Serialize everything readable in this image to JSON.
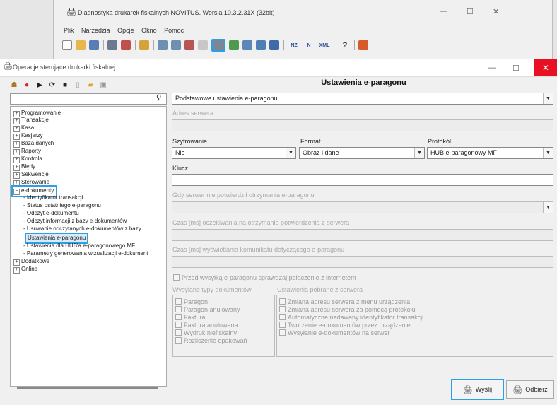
{
  "background_window": {
    "title": "Diagnostyka drukarek fiskalnych NOVITUS. Wersja 10.3.2.31X (32bit)",
    "menu": [
      "Plik",
      "Narzedzia",
      "Opcje",
      "Okno",
      "Pomoc"
    ],
    "toolbar_text": [
      "NZ",
      "N",
      "XML",
      "?"
    ],
    "window_controls": [
      "—",
      "☐",
      "✕"
    ]
  },
  "main_window": {
    "title": "Operacje sterujące drukarki fiskalnej",
    "window_controls": [
      "—",
      "☐",
      "✕"
    ]
  },
  "tree": {
    "top_items": [
      "Programowanie",
      "Transakcje",
      "Kasa",
      "Kasjerzy",
      "Baza danych",
      "Raporty",
      "Kontrola",
      "Błędy",
      "Sekwencje",
      "Sterowanie"
    ],
    "expanded": "e-dokumenty",
    "children": [
      "Identyfikator transakcji",
      "Status ostatniego e-paragonu",
      "Odczyt e-dokumentu",
      "Odczyt informacji z bazy e-dokumentów",
      "Usuwanie odczytanych e-dokumentów z bazy",
      "Ustawienia e-paragonu",
      "Ustawienia dla HUB'a e-paragonowego MF",
      "Parametry generowania wizualizacji e-dokument"
    ],
    "bottom_items": [
      "Dodatkowe",
      "Online"
    ]
  },
  "settings": {
    "title": "Ustawienia e-paragonu",
    "category_select": "Podstawowe ustawienia e-paragonu",
    "server_address_label": "Adres serwera",
    "encryption_label": "Szyfrowanie",
    "encryption_value": "Nie",
    "format_label": "Format",
    "format_value": "Obraz i dane",
    "protocol_label": "Protokół",
    "protocol_value": "HUB e-paragonowy MF",
    "key_label": "Klucz",
    "not_confirmed_label": "Gdy serwer nie potwierdził otrzymania e-paragonu",
    "wait_label": "Czas [ms] oczekiwania na otrzymanie potwierdzenia z serwera",
    "display_label": "Czas [ms] wyświetlania komunikatu dotyczącego e-paragonu",
    "check_connection": "Przed wysyłką e-paragonu sprawdzaj połączenie z internetem",
    "doc_types_label": "Wysyłane typy dokumentów",
    "doc_types": [
      "Paragon",
      "Paragon anulowany",
      "Faktura",
      "Faktura anulowana",
      "Wydruk niefiskalny",
      "Rozliczenie opakowań"
    ],
    "server_settings_label": "Ustawienia pobrane z serwera",
    "server_settings": [
      "Zmiana adresu serwera z menu urządzenia",
      "Zmiana adresu serwera za pomocą protokołu",
      "Automatyczne nadawany identyfikator transakcji",
      "Tworzenie e-dokumentów przez urządzenie",
      "Wysyłanie e-dokumentów na serwer"
    ],
    "send_button": "Wyślij",
    "receive_button": "Odbierz"
  },
  "colors": {
    "highlight": "#2aa0e8",
    "close_button": "#e81123"
  }
}
